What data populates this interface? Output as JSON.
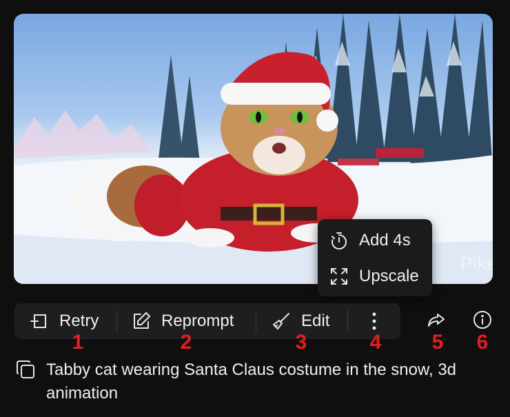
{
  "video": {
    "watermark": "Pika"
  },
  "popup_menu": {
    "items": [
      {
        "label": "Add 4s",
        "icon": "timer-icon"
      },
      {
        "label": "Upscale",
        "icon": "expand-icon"
      }
    ]
  },
  "toolbar": {
    "buttons": [
      {
        "label": "Retry",
        "icon": "retry-icon"
      },
      {
        "label": "Reprompt",
        "icon": "pencil-icon"
      },
      {
        "label": "Edit",
        "icon": "brush-icon"
      }
    ],
    "more_icon": "more-vertical-icon",
    "share_icon": "share-icon",
    "info_icon": "info-icon"
  },
  "annotations": [
    "1",
    "2",
    "3",
    "4",
    "5",
    "6"
  ],
  "annotation_color": "#e02020",
  "caption": {
    "text": "Tabby cat wearing Santa Claus costume in the snow, 3d animation",
    "copy_icon": "copy-icon"
  }
}
